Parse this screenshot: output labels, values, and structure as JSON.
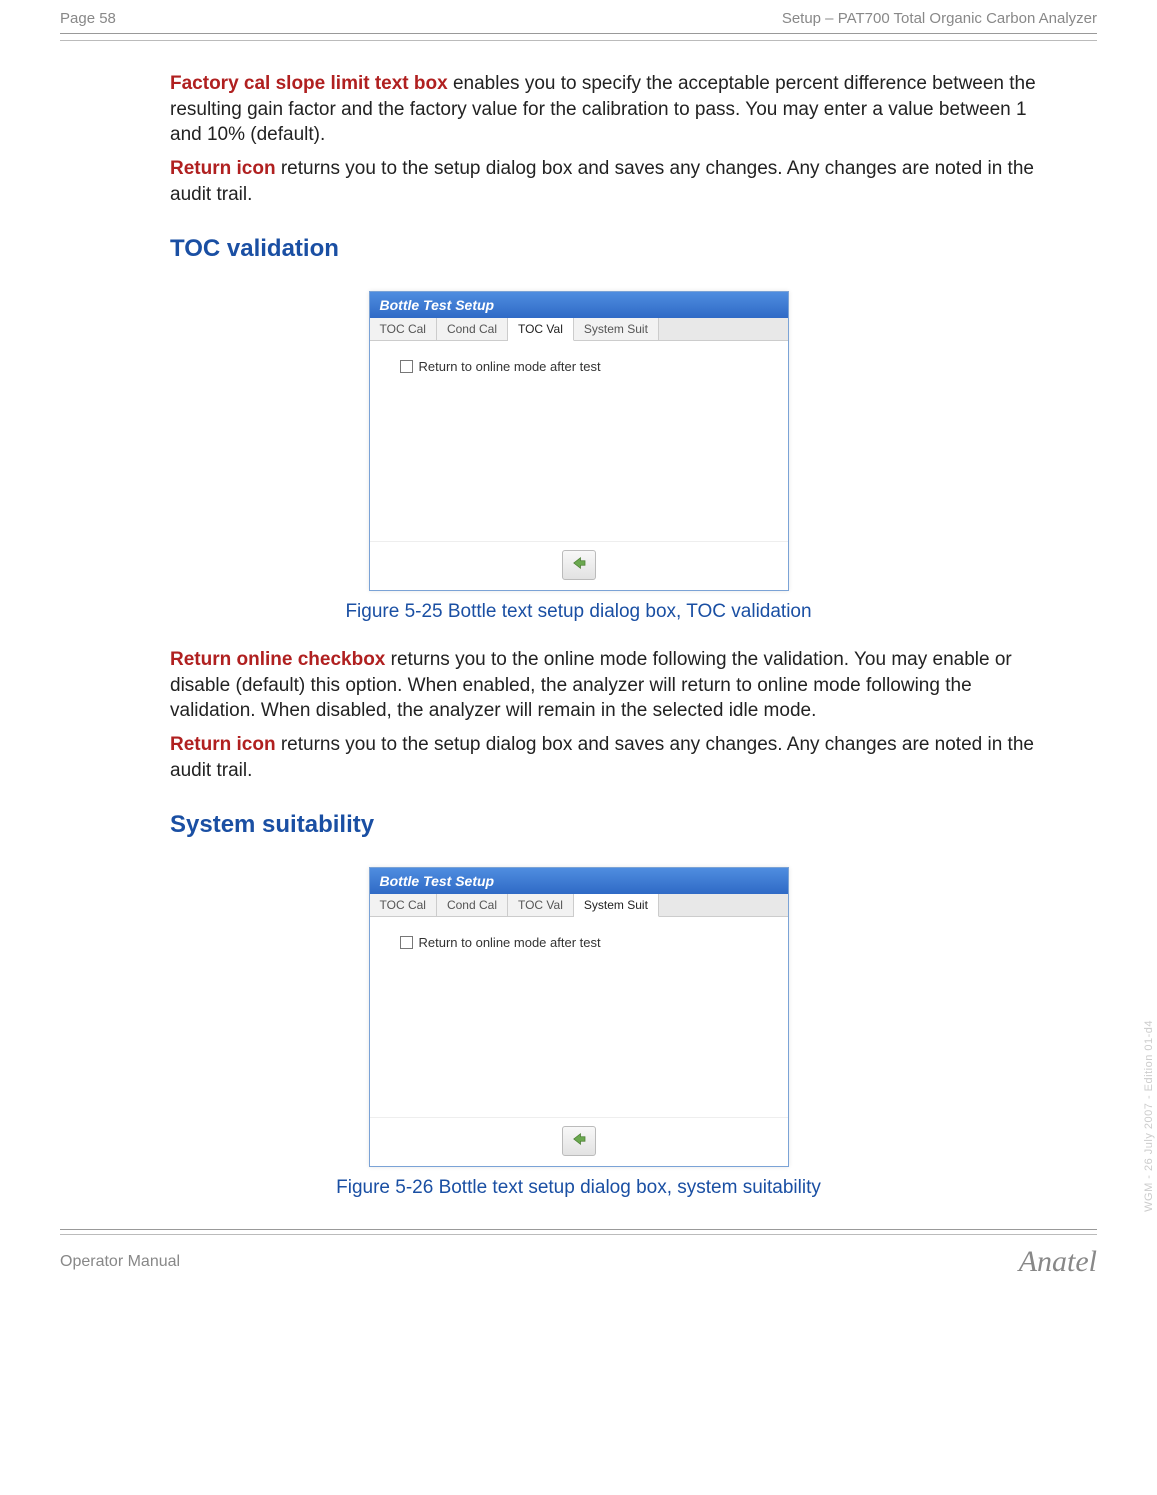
{
  "header": {
    "page_label": "Page 58",
    "doc_title": "Setup – PAT700 Total Organic Carbon Analyzer"
  },
  "para1": {
    "lead": "Factory cal slope limit text box",
    "rest": " enables you to specify the acceptable percent difference between the resulting gain factor and the factory value for the calibration to pass. You may enter a value between 1 and 10% (default)."
  },
  "para2": {
    "lead": "Return icon",
    "rest": " returns you to the setup dialog box and saves any changes. Any changes are noted in the audit trail."
  },
  "section1_heading": "TOC validation",
  "dialog1": {
    "title": "Bottle Test Setup",
    "tabs": [
      "TOC Cal",
      "Cond Cal",
      "TOC Val",
      "System Suit"
    ],
    "active_tab_index": 2,
    "checkbox_label": "Return to online mode after test"
  },
  "figure1_caption": "Figure 5-25 Bottle text setup dialog box, TOC validation",
  "para3": {
    "lead": "Return online checkbox",
    "rest": " returns you to the online mode following the validation. You may enable or disable (default) this option. When enabled, the analyzer will return to online mode following the validation. When disabled, the analyzer will remain in the selected idle mode."
  },
  "para4": {
    "lead": "Return icon",
    "rest": " returns you to the setup dialog box and saves any changes. Any changes are noted in the audit trail."
  },
  "section2_heading": "System suitability",
  "dialog2": {
    "title": "Bottle Test Setup",
    "tabs": [
      "TOC Cal",
      "Cond Cal",
      "TOC Val",
      "System Suit"
    ],
    "active_tab_index": 3,
    "checkbox_label": "Return to online mode after test"
  },
  "figure2_caption": "Figure 5-26 Bottle text setup dialog box, system suitability",
  "footer": {
    "left": "Operator Manual",
    "right": "Anatel"
  },
  "side_note": "WGM - 26 July 2007 - Edition 01-d4"
}
